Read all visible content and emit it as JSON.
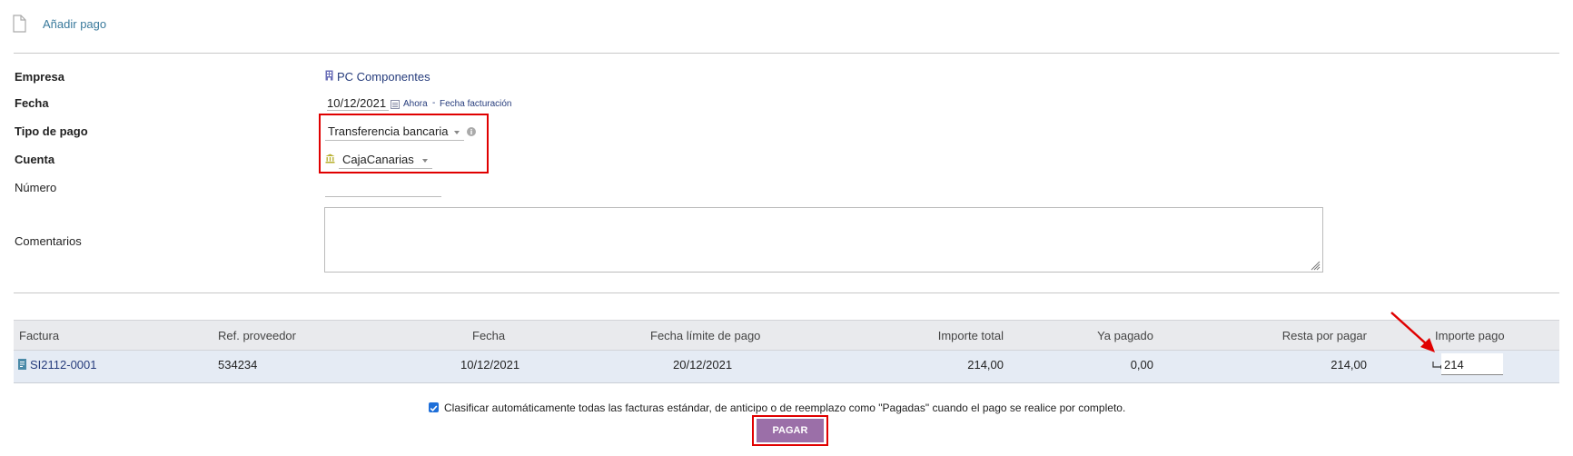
{
  "header": {
    "title": "Añadir pago"
  },
  "form": {
    "empresa_label": "Empresa",
    "empresa_value": "PC Componentes",
    "fecha_label": "Fecha",
    "fecha_value": "10/12/2021",
    "fecha_now": "Ahora",
    "fecha_sep": "-",
    "fecha_invoice": "Fecha facturación",
    "tipo_label": "Tipo de pago",
    "tipo_value": "Transferencia bancaria",
    "cuenta_label": "Cuenta",
    "cuenta_value": "CajaCanarias",
    "numero_label": "Número",
    "numero_value": "",
    "comentarios_label": "Comentarios",
    "comentarios_value": ""
  },
  "table": {
    "headers": [
      "Factura",
      "Ref. proveedor",
      "Fecha",
      "Fecha límite de pago",
      "Importe total",
      "Ya pagado",
      "Resta por pagar",
      "Importe pago"
    ],
    "row": {
      "factura": "SI2112-0001",
      "ref": "534234",
      "fecha": "10/12/2021",
      "limite": "20/12/2021",
      "total": "214,00",
      "pagado": "0,00",
      "resta": "214,00",
      "importe_pago": "214"
    }
  },
  "footer": {
    "checkbox_label": "Clasificar automáticamente todas las facturas estándar, de anticipo o de reemplazo como \"Pagadas\" cuando el pago se realice por completo.",
    "checkbox_checked": true,
    "pay_button": "PAGAR"
  },
  "colors": {
    "accent": "#9b6fa8",
    "highlight": "#e00000",
    "header_row": "#e9eaed",
    "data_row": "#e5ebf4"
  }
}
